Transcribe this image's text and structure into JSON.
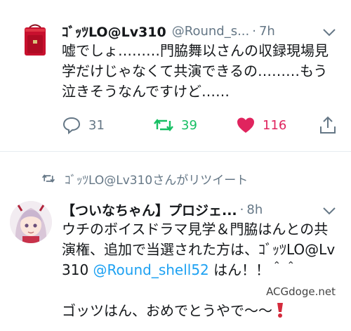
{
  "tweets": [
    {
      "name": "ｺﾞｯﾂLO@Lv310",
      "handle": "@Round_s...",
      "dot": "·",
      "time": "7h",
      "text": "嘘でしょ………門脇舞以さんの収録現場見学だけじゃなくて共演できるの………もう泣きそうなんですけど……",
      "replies": "31",
      "retweets": "39",
      "likes": "116",
      "icons": [
        "bag-avatar",
        "chevron-down-icon",
        "reply-icon",
        "retweet-icon",
        "heart-icon",
        "share-icon"
      ]
    },
    {
      "retweeted_by": "ｺﾞｯﾂLO@Lv310さんがリツイート",
      "name": "【ついなちゃん】プロジェ...",
      "dot": "·",
      "time": "8h",
      "text_part1": "ウチのボイスドラマ見学＆門脇はんとの共演権、追加で当選された方は、ｺﾞｯﾂLO@Lv310 ",
      "mention": "@Round_shell52",
      "text_part2": " はん！！＾＾",
      "text_line2": "ゴッツはん、おめでとうやで〜〜",
      "icons": [
        "anime-avatar",
        "retweet-small-icon",
        "chevron-down-icon",
        "red-exclamation-emoji"
      ]
    }
  ],
  "watermark": "ACGdoge.net",
  "colors": {
    "text": "#14171a",
    "muted": "#657786",
    "link": "#1da1f2",
    "retweet": "#17bf63",
    "like": "#e0245e",
    "divider": "#e6ecf0"
  }
}
